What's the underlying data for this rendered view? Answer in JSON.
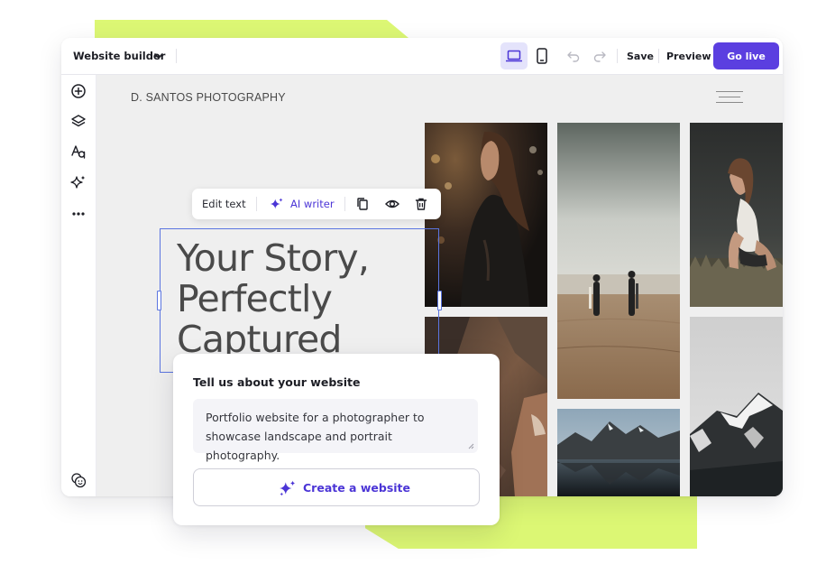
{
  "topbar": {
    "title": "Website builder",
    "save_label": "Save",
    "preview_label": "Preview",
    "golive_label": "Go live"
  },
  "site": {
    "logo_text": "D. SANTOS PHOTOGRAPHY"
  },
  "text_toolbar": {
    "edit_text_label": "Edit text",
    "ai_writer_label": "AI writer"
  },
  "hero": {
    "line1": "Your Story,",
    "line2": "Perfectly",
    "line3": "Captured"
  },
  "ai_panel": {
    "title": "Tell us about your website",
    "prompt_value": "Portfolio website for a photographer to showcase landscape and portrait photography.",
    "create_button_label": "Create a website"
  },
  "colors": {
    "accent": "#5b3fe0",
    "accent_text": "#4b35d6",
    "highlight_green": "#dcf774",
    "selection_blue": "#5b75e0",
    "canvas_bg": "#efefef"
  },
  "icons": {
    "sidebar": [
      "add-icon",
      "layers-icon",
      "typography-icon",
      "sparkle-icon",
      "more-icon",
      "emoji-icon"
    ],
    "topbar": [
      "chevron-down-icon",
      "desktop-icon",
      "mobile-icon",
      "undo-icon",
      "redo-icon"
    ],
    "text_toolbar": [
      "sparkle-icon",
      "copy-icon",
      "eye-icon",
      "trash-icon"
    ]
  }
}
